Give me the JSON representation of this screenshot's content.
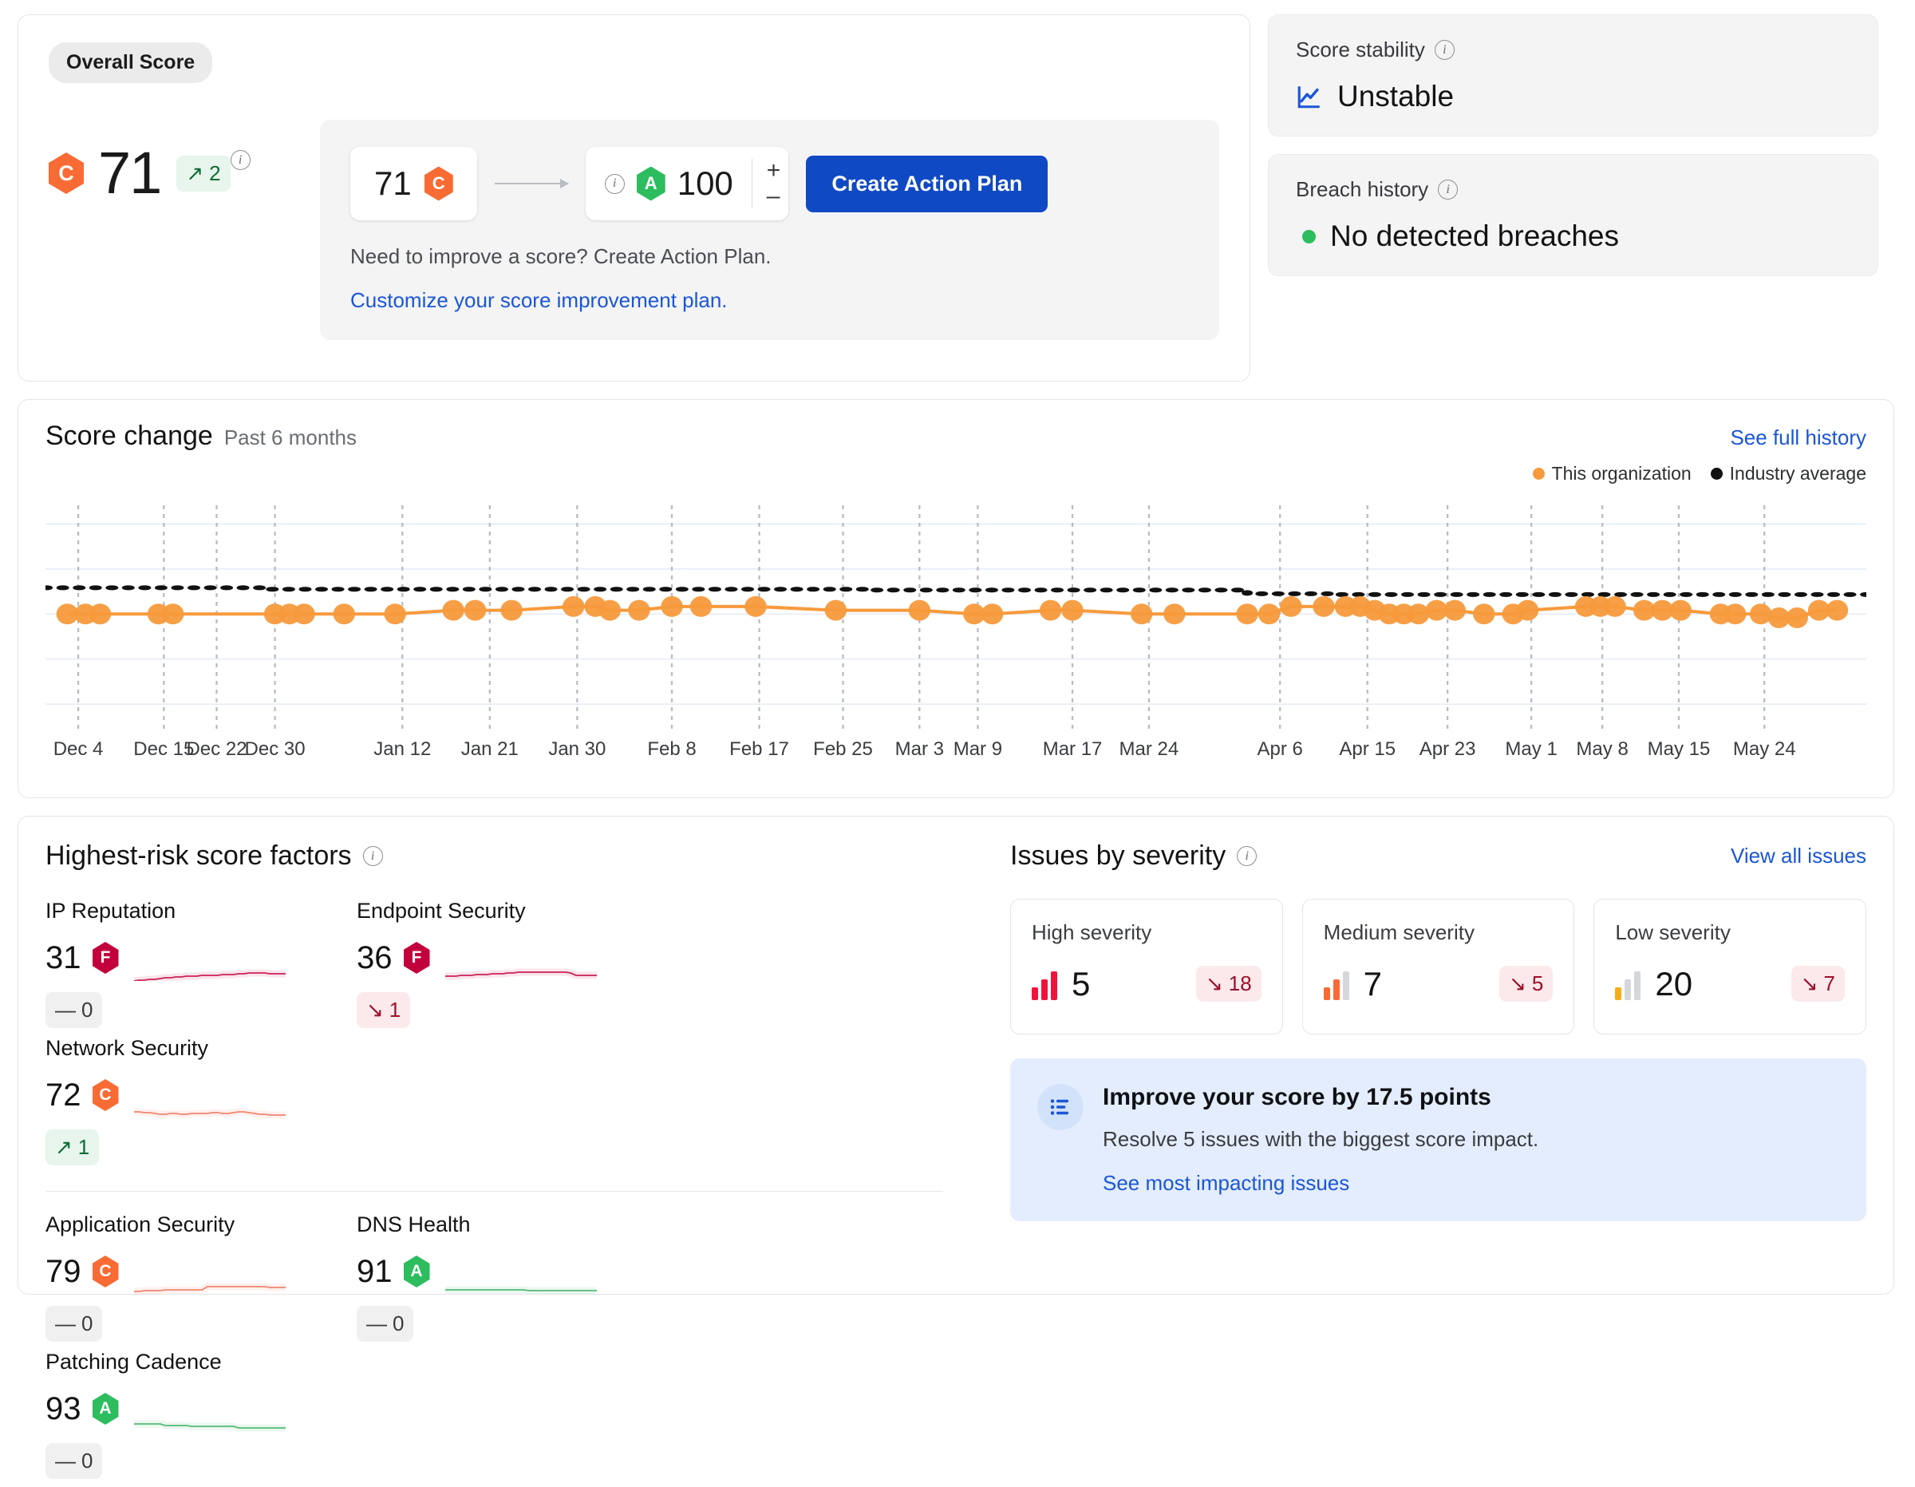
{
  "overall": {
    "pill_label": "Overall Score",
    "score": "71",
    "grade": "C",
    "grade_color": "#f96b35",
    "delta_arrow": "↗",
    "delta_value": "2",
    "info_icon": "info-icon"
  },
  "plan": {
    "current_score": "71",
    "current_grade": "C",
    "target_score": "100",
    "target_grade": "A",
    "stepper_increase": "+",
    "stepper_decrease": "–",
    "cta_label": "Create Action Plan",
    "hint": "Need to improve a score? Create Action Plan.",
    "link": "Customize your score improvement plan."
  },
  "stability": {
    "title": "Score stability",
    "value": "Unstable"
  },
  "breach": {
    "title": "Breach history",
    "value": "No detected breaches",
    "status_color": "#2dbd5e"
  },
  "score_change": {
    "title": "Score change",
    "subtitle": "Past 6 months",
    "link": "See full history",
    "legend": [
      {
        "label": "This organization",
        "color": "#f79a3c"
      },
      {
        "label": "Industry average",
        "color": "#111111"
      }
    ]
  },
  "chart_data": {
    "type": "line",
    "title": "Score change",
    "subtitle": "Past 6 months",
    "xlabel": "",
    "ylabel": "",
    "ylim": [
      40,
      100
    ],
    "grid": true,
    "legend_position": "top-right",
    "gridlines_y": [
      95,
      83,
      71,
      59,
      47
    ],
    "tick_labels": [
      "Dec 4",
      "Dec 15",
      "Dec 22",
      "Dec 30",
      "Jan 12",
      "Jan 21",
      "Jan 30",
      "Feb 8",
      "Feb 17",
      "Feb 25",
      "Mar 3",
      "Mar 9",
      "Mar 17",
      "Mar 24",
      "Apr 6",
      "Apr 15",
      "Apr 23",
      "May 1",
      "May 8",
      "May 15",
      "May 24"
    ],
    "tick_positions": [
      1.8,
      6.5,
      9.4,
      12.6,
      19.6,
      24.4,
      29.2,
      34.4,
      39.2,
      43.8,
      48.0,
      51.2,
      56.4,
      60.6,
      67.8,
      72.6,
      77.0,
      81.6,
      85.5,
      89.7,
      94.4
    ],
    "series": [
      {
        "name": "This organization",
        "color": "#f79a3c",
        "style": "solid-markers",
        "x": [
          1.2,
          2.2,
          3.0,
          6.2,
          7.0,
          12.6,
          13.4,
          14.2,
          16.4,
          19.2,
          22.4,
          23.6,
          25.6,
          29.0,
          30.2,
          31.0,
          32.6,
          34.4,
          36.0,
          39.0,
          43.4,
          48.0,
          51.0,
          52.0,
          55.2,
          56.4,
          60.2,
          62.0,
          66.0,
          67.2,
          68.4,
          70.2,
          71.4,
          72.2,
          73.0,
          73.8,
          74.6,
          75.4,
          76.4,
          77.4,
          79.0,
          80.6,
          81.4,
          84.6,
          85.4,
          86.2,
          87.8,
          88.8,
          89.8,
          92.0,
          92.8,
          94.2,
          95.2,
          96.2,
          97.4,
          98.4
        ],
        "y": [
          71,
          71,
          71,
          71,
          71,
          71,
          71,
          71,
          71,
          71,
          72,
          72,
          72,
          73,
          73,
          72,
          72,
          73,
          73,
          73,
          72,
          72,
          71,
          71,
          72,
          72,
          71,
          71,
          71,
          71,
          73,
          73,
          73,
          73,
          72,
          71,
          71,
          71,
          72,
          72,
          71,
          71,
          72,
          73,
          73,
          73,
          72,
          72,
          72,
          71,
          71,
          71,
          70,
          70,
          72,
          72
        ]
      },
      {
        "name": "Industry average",
        "color": "#111111",
        "style": "dotted",
        "x": [
          0,
          12,
          12,
          45,
          45,
          66,
          66,
          71,
          71,
          100
        ],
        "y": [
          78,
          78,
          77.6,
          77.6,
          77.4,
          77.4,
          76.4,
          76.4,
          76.2,
          76.2
        ]
      }
    ]
  },
  "factors": {
    "title": "Highest-risk score factors",
    "items": [
      {
        "name": "IP Reputation",
        "score": "31",
        "grade": "F",
        "grade_color": "#c2003c",
        "delta_arrow": "—",
        "delta_value": "0",
        "delta_type": "flat",
        "spark_color": "#c2003c",
        "spark": [
          58,
          57,
          57,
          56,
          56,
          55,
          54,
          54,
          53,
          53,
          52,
          52,
          52,
          51,
          51,
          51,
          51,
          50,
          50,
          50,
          49,
          49,
          48,
          48,
          48,
          48,
          49,
          49,
          49,
          49
        ]
      },
      {
        "name": "Endpoint Security",
        "score": "36",
        "grade": "F",
        "grade_color": "#c2003c",
        "delta_arrow": "↘",
        "delta_value": "1",
        "delta_type": "down",
        "spark_color": "#c2003c",
        "spark": [
          52,
          52,
          52,
          51,
          51,
          51,
          50,
          50,
          50,
          49,
          49,
          49,
          48,
          48,
          47,
          47,
          47,
          47,
          47,
          47,
          47,
          47,
          47,
          47,
          48,
          51,
          51,
          51,
          51,
          51
        ]
      },
      {
        "name": "Network Security",
        "score": "72",
        "grade": "C",
        "grade_color": "#f96b35",
        "delta_arrow": "↗",
        "delta_value": "1",
        "delta_type": "up",
        "spark_color": "#f0735a",
        "spark": [
          50,
          50,
          51,
          51,
          52,
          53,
          53,
          52,
          52,
          53,
          53,
          52,
          52,
          52,
          52,
          51,
          51,
          52,
          52,
          51,
          50,
          50,
          51,
          52,
          53,
          53,
          54,
          54,
          54,
          54
        ]
      },
      {
        "name": "Application Security",
        "score": "79",
        "grade": "C",
        "grade_color": "#f96b35",
        "delta_arrow": "—",
        "delta_value": "0",
        "delta_type": "flat",
        "spark_color": "#f0735a",
        "spark": [
          54,
          54,
          53,
          53,
          53,
          53,
          52,
          52,
          52,
          52,
          52,
          52,
          52,
          52,
          48,
          48,
          48,
          48,
          48,
          48,
          48,
          48,
          48,
          48,
          48,
          48,
          49,
          49,
          49,
          49
        ]
      },
      {
        "name": "DNS Health",
        "score": "91",
        "grade": "A",
        "grade_color": "#2dbd5e",
        "delta_arrow": "—",
        "delta_value": "0",
        "delta_type": "flat",
        "spark_color": "#38b05f",
        "spark": [
          52,
          52,
          52,
          52,
          52,
          52,
          52,
          52,
          52,
          52,
          52,
          52,
          52,
          52,
          52,
          52,
          53,
          53,
          53,
          53,
          53,
          53,
          53,
          53,
          53,
          53,
          53,
          53,
          53,
          53
        ]
      },
      {
        "name": "Patching Cadence",
        "score": "93",
        "grade": "A",
        "grade_color": "#2dbd5e",
        "delta_arrow": "—",
        "delta_value": "0",
        "delta_type": "flat",
        "spark_color": "#38b05f",
        "spark": [
          48,
          48,
          48,
          48,
          48,
          48,
          50,
          50,
          50,
          50,
          50,
          51,
          51,
          51,
          51,
          51,
          51,
          51,
          51,
          51,
          53,
          53,
          53,
          53,
          53,
          53,
          53,
          53,
          53,
          53
        ]
      }
    ]
  },
  "issues": {
    "title": "Issues by severity",
    "link": "View all issues",
    "cards": [
      {
        "label": "High severity",
        "count": "5",
        "delta_arrow": "↘",
        "delta_value": "18",
        "bar_colors": [
          "#f0143c",
          "#f0143c",
          "#f0143c"
        ]
      },
      {
        "label": "Medium severity",
        "count": "7",
        "delta_arrow": "↘",
        "delta_value": "5",
        "bar_colors": [
          "#f96b35",
          "#f96b35",
          "#d5d7da"
        ]
      },
      {
        "label": "Low severity",
        "count": "20",
        "delta_arrow": "↘",
        "delta_value": "7",
        "bar_colors": [
          "#f5ad1c",
          "#d5d7da",
          "#d5d7da"
        ]
      }
    ]
  },
  "improve": {
    "title": "Improve your score by 17.5 points",
    "subtitle": "Resolve 5 issues with the biggest score impact.",
    "link": "See most impacting issues"
  }
}
